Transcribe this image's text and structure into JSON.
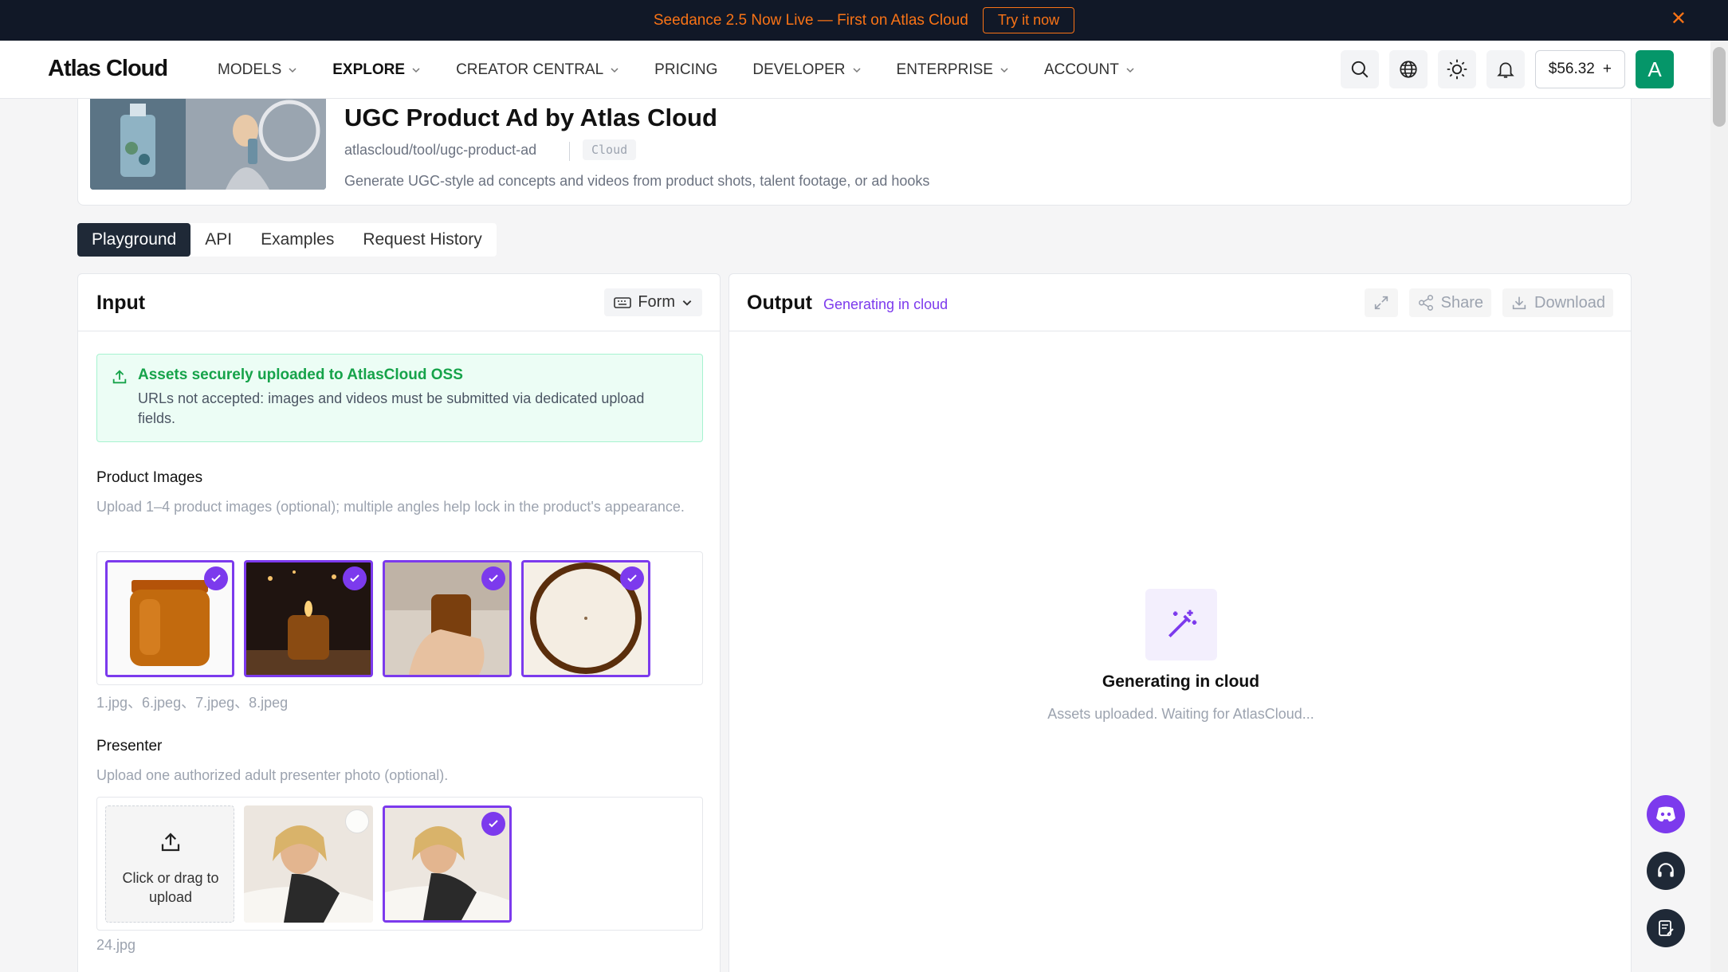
{
  "banner": {
    "text": "Seedance 2.5 Now Live — First on Atlas Cloud",
    "cta": "Try it now",
    "close": "✕"
  },
  "nav": {
    "logo": "Atlas Cloud",
    "items": [
      {
        "label": "MODELS",
        "dropdown": true
      },
      {
        "label": "EXPLORE",
        "dropdown": true,
        "active": true
      },
      {
        "label": "CREATOR CENTRAL",
        "dropdown": true
      },
      {
        "label": "PRICING",
        "dropdown": false
      },
      {
        "label": "DEVELOPER",
        "dropdown": true
      },
      {
        "label": "ENTERPRISE",
        "dropdown": true
      },
      {
        "label": "ACCOUNT",
        "dropdown": true
      }
    ],
    "balance": "$56.32",
    "balance_add": "+",
    "avatar_initial": "A"
  },
  "header": {
    "title": "UGC Product Ad by Atlas Cloud",
    "slug": "atlascloud/tool/ugc-product-ad",
    "tag": "Cloud",
    "description": "Generate UGC-style ad concepts and videos from product shots, talent footage, or ad hooks"
  },
  "tabs": [
    "Playground",
    "API",
    "Examples",
    "Request History"
  ],
  "input": {
    "title": "Input",
    "mode_label": "Form",
    "notice": {
      "title": "Assets securely uploaded to AtlasCloud OSS",
      "body": "URLs not accepted: images and videos must be submitted via dedicated upload fields."
    },
    "product_images": {
      "label": "Product Images",
      "help": "Upload 1–4 product images (optional); multiple angles help lock in the product's appearance.",
      "files": "1.jpg、6.jpeg、7.jpeg、8.jpeg",
      "selected": 4
    },
    "presenter": {
      "label": "Presenter",
      "help": "Upload one authorized adult presenter photo (optional).",
      "upload_text": "Click or drag to upload",
      "files": "24.jpg"
    }
  },
  "output": {
    "title": "Output",
    "status": "Generating in cloud",
    "share": "Share",
    "download": "Download",
    "empty_title": "Generating in cloud",
    "empty_sub": "Assets uploaded. Waiting for AtlasCloud..."
  },
  "colors": {
    "accent": "#7c3aed",
    "banner_text": "#f97316",
    "success": "#16a34a",
    "avatar": "#059669"
  }
}
